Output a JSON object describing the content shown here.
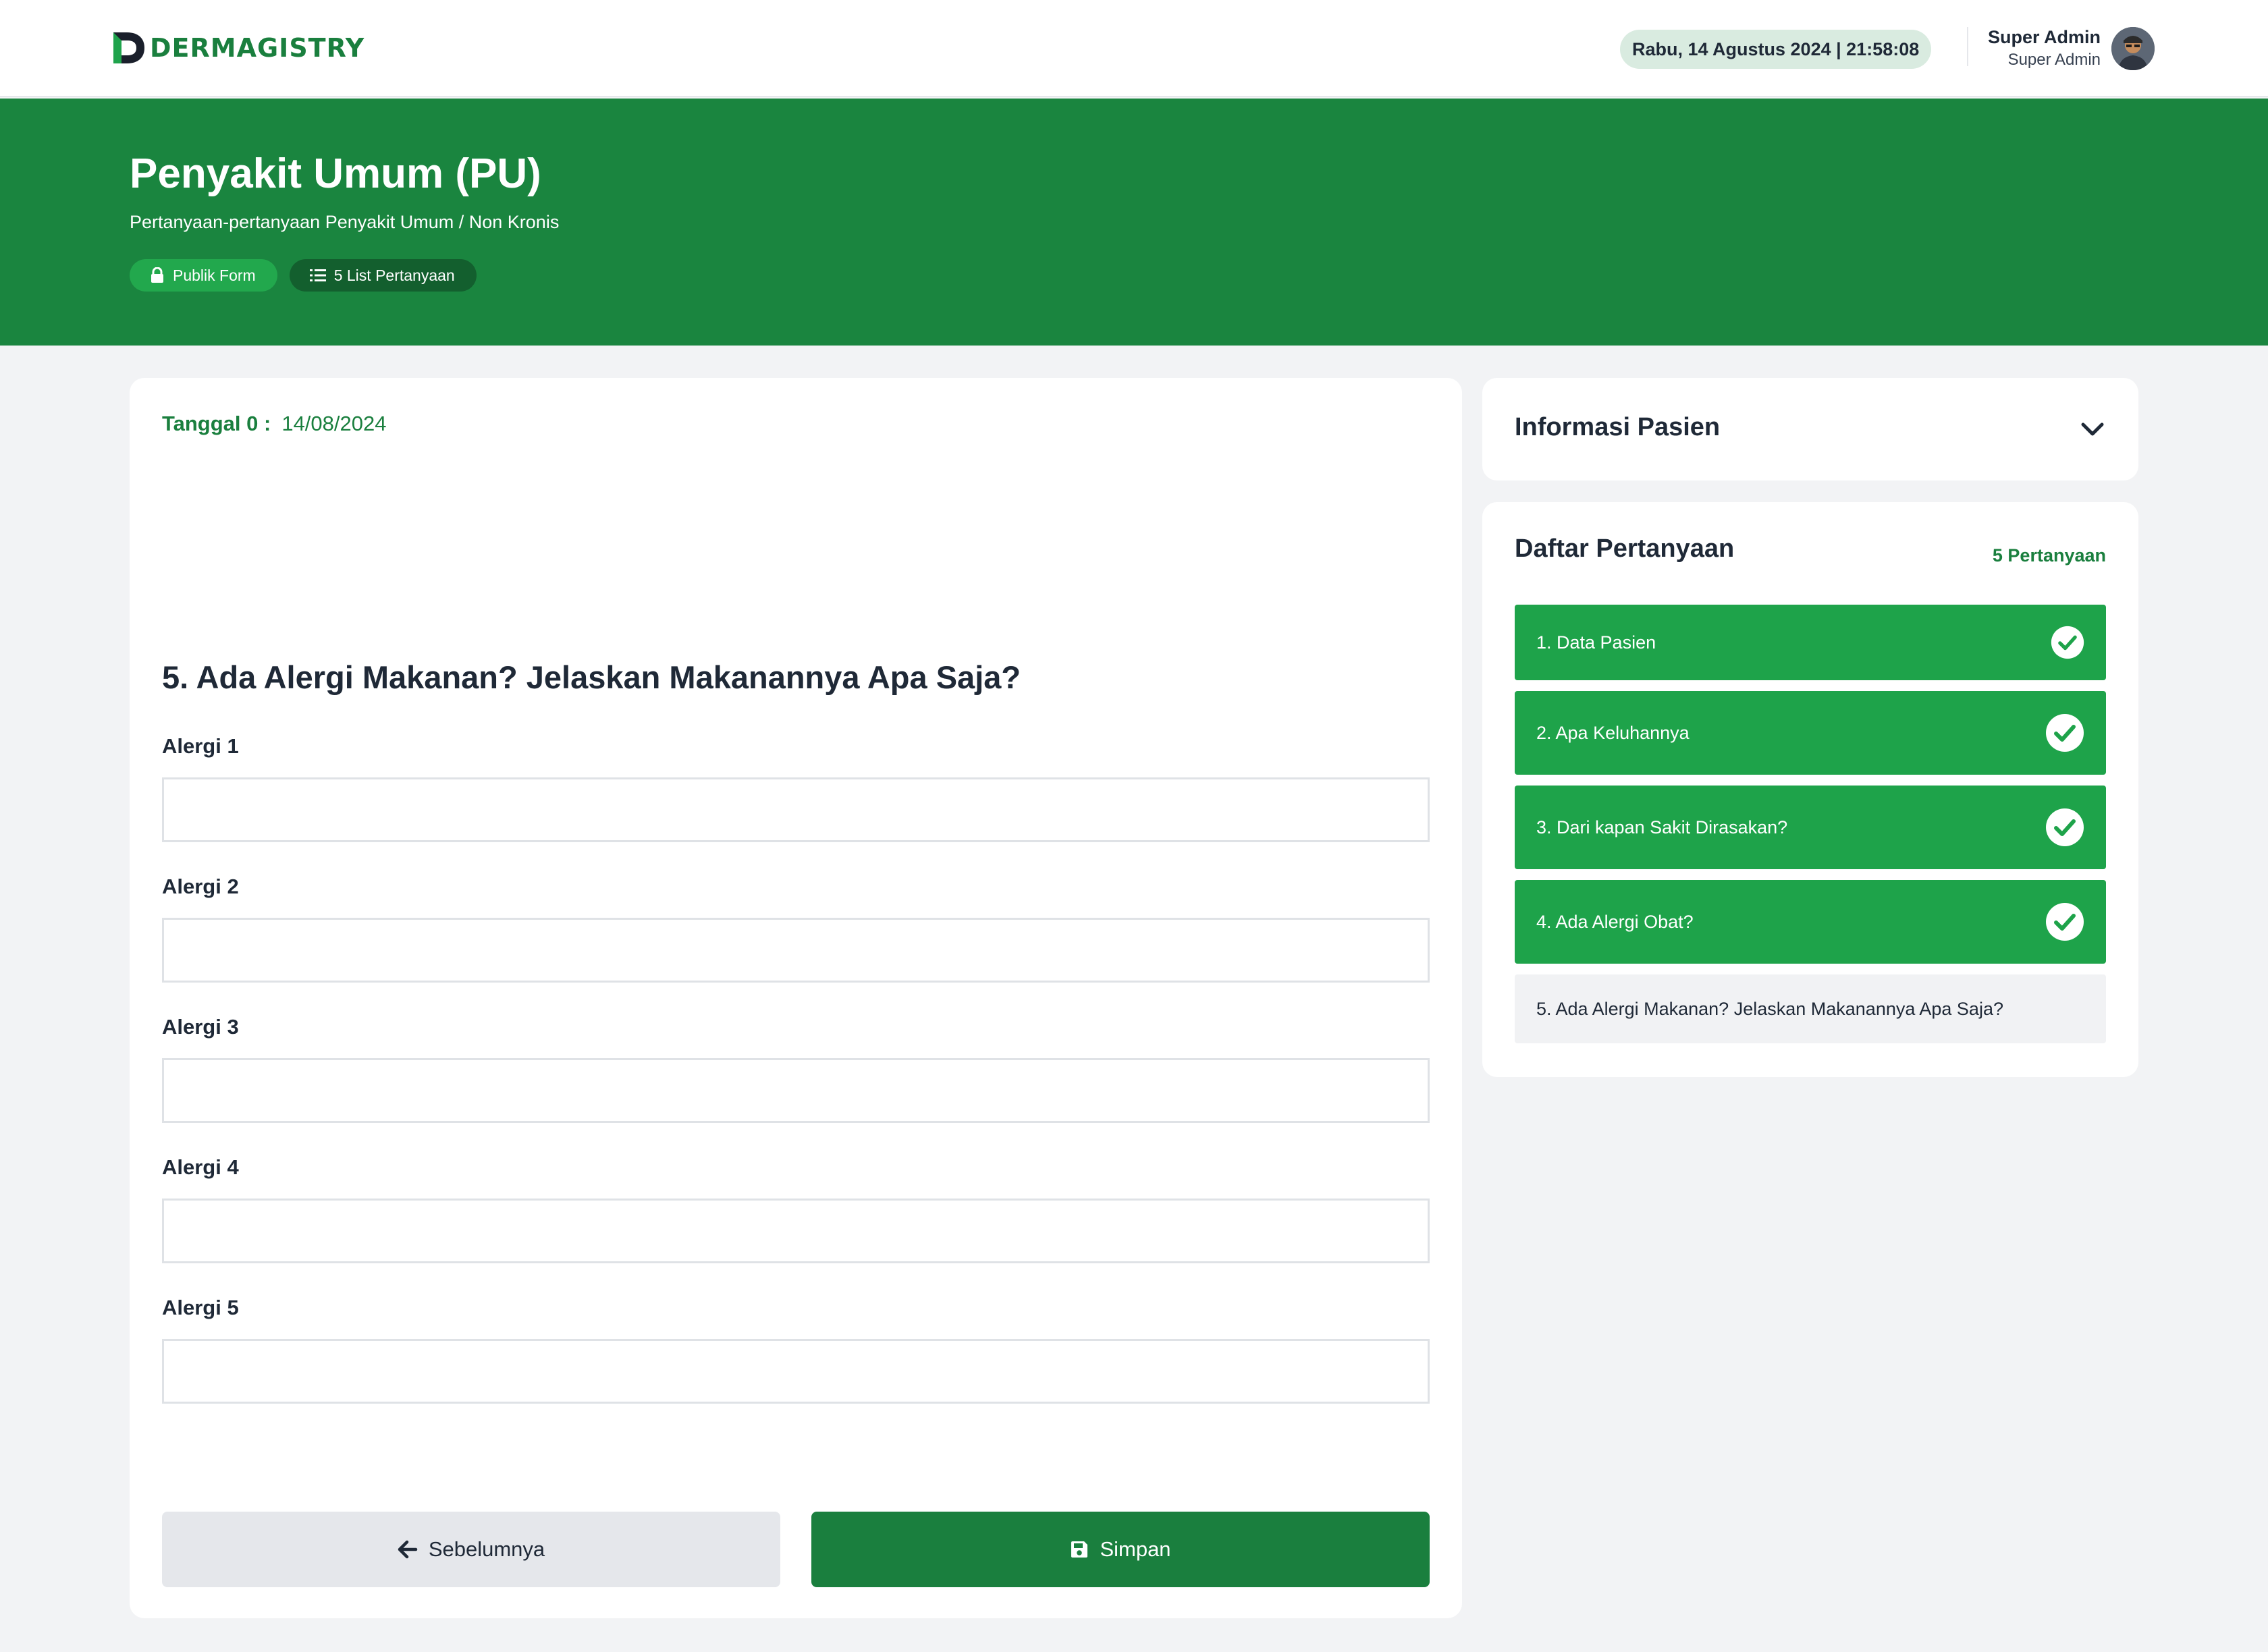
{
  "brand": {
    "name": "DERMAGISTRY"
  },
  "header": {
    "datetime": "Rabu, 14 Agustus 2024 | 21:58:08",
    "user_name": "Super Admin",
    "user_role": "Super Admin"
  },
  "hero": {
    "title": "Penyakit Umum (PU)",
    "subtitle": "Pertanyaan-pertanyaan Penyakit Umum / Non Kronis",
    "badge_public": "Publik Form",
    "badge_list": "5 List Pertanyaan"
  },
  "form": {
    "date_label": "Tanggal 0 :",
    "date_value": "14/08/2024",
    "question": "5. Ada Alergi Makanan? Jelaskan Makanannya Apa Saja?",
    "fields": [
      {
        "label": "Alergi 1",
        "value": ""
      },
      {
        "label": "Alergi 2",
        "value": ""
      },
      {
        "label": "Alergi 3",
        "value": ""
      },
      {
        "label": "Alergi 4",
        "value": ""
      },
      {
        "label": "Alergi 5",
        "value": ""
      }
    ],
    "prev_label": "Sebelumnya",
    "save_label": "Simpan"
  },
  "patient_info": {
    "title": "Informasi Pasien"
  },
  "question_list": {
    "title": "Daftar Pertanyaan",
    "count": "5 Pertanyaan",
    "items": [
      {
        "label": "1. Data Pasien",
        "status": "done"
      },
      {
        "label": "2. Apa Keluhannya",
        "status": "done"
      },
      {
        "label": "3. Dari kapan Sakit Dirasakan?",
        "status": "done"
      },
      {
        "label": "4. Ada Alergi Obat?",
        "status": "done"
      },
      {
        "label": "5. Ada Alergi Makanan? Jelaskan Makanannya Apa Saja?",
        "status": "current"
      }
    ]
  },
  "colors": {
    "brand_green": "#1a7f3e",
    "hero_green": "#1a853f",
    "item_done": "#1ea34a",
    "page_bg": "#f2f3f5"
  }
}
